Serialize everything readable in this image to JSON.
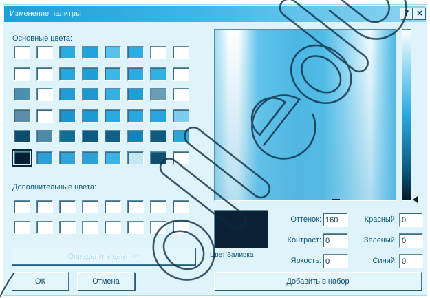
{
  "window": {
    "title": "Изменение палитры",
    "help_glyph": "?",
    "close_glyph": "×"
  },
  "basic_colors": {
    "label": "Основные цвета:",
    "selected_index": 40,
    "swatches": [
      "#ffffff",
      "#ffffff",
      "#2bacdf",
      "#22a4da",
      "#56c1ea",
      "#2aaee3",
      "#ffffff",
      "#ffffff",
      "#ffffff",
      "#ffffff",
      "#25a8de",
      "#1f9fd6",
      "#3cb7e6",
      "#2aace0",
      "#31b1e3",
      "#ffffff",
      "#4d8fae",
      "#ffffff",
      "#1f9ed6",
      "#1a98d0",
      "#32b0e2",
      "#1f9fd8",
      "#6a9db5",
      "#ffffff",
      "#5d8ea5",
      "#ffffff",
      "#1b96cd",
      "#1d9ad2",
      "#2aa9de",
      "#2aa8de",
      "#26a6dc",
      "#7ccdee",
      "#0d4c6c",
      "#4e8ba6",
      "#116c96",
      "#0d5b82",
      "#105f86",
      "#1583b5",
      "#0f5a80",
      "#2aa6db",
      "#071f33",
      "#2aa1d6",
      "#2ea4d8",
      "#2aa2d7",
      "#3bb3e6",
      "#c2e8f6",
      "#0e4f72",
      "#ffffff"
    ]
  },
  "custom_colors": {
    "label": "Дополнительные цвета:",
    "swatches": [
      "#ffffff",
      "#ffffff",
      "#ffffff",
      "#ffffff",
      "#ffffff",
      "#ffffff",
      "#ffffff",
      "#ffffff",
      "#ffffff",
      "#ffffff",
      "#ffffff",
      "#ffffff",
      "#ffffff",
      "#ffffff",
      "#ffffff",
      "#ffffff"
    ]
  },
  "buttons": {
    "define": "Определить цвет >>",
    "ok": "ОК",
    "cancel": "Отмена",
    "add": "Добавить в набор"
  },
  "preview": {
    "label": "Цвет|Заливка",
    "color": "#0b2236"
  },
  "fields": {
    "hue": {
      "label": "Оттенок:",
      "value": "160"
    },
    "saturation": {
      "label": "Контраст:",
      "value": "0"
    },
    "luminance": {
      "label": "Яркость:",
      "value": "0"
    },
    "red": {
      "label": "Красный:",
      "value": "0"
    },
    "green": {
      "label": "Зеленый:",
      "value": "0"
    },
    "blue": {
      "label": "Синий:",
      "value": "0"
    }
  },
  "icons": {
    "help": "help-icon",
    "close": "close-icon",
    "crosshair": "crosshair-icon",
    "luminance_arrow": "arrow-left-icon"
  },
  "colors": {
    "title_bar": "#1f9fd8",
    "dialog_background": "#dff3fb",
    "watermark": "#0b2a40"
  }
}
